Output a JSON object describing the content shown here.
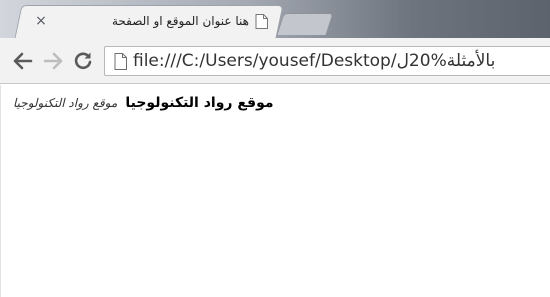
{
  "tab": {
    "title": "هنا عنوان الموقع او الصفحة",
    "close_glyph": "×"
  },
  "toolbar": {
    "back_icon": "arrow-left-icon",
    "forward_icon": "arrow-right-icon",
    "reload_icon": "reload-icon",
    "page_icon": "page-icon",
    "url": "file:///C:/Users/yousef/Desktop/بالأمثلة%20ل"
  },
  "content": {
    "bold_text": "موقع رواد التكنولوجيا",
    "italic_text": "موقع رواد التكنولوجيا"
  },
  "colors": {
    "tab_background": "#f2f2f2",
    "titlebar_dark": "#5d636d",
    "page_background": "#ffffff"
  }
}
